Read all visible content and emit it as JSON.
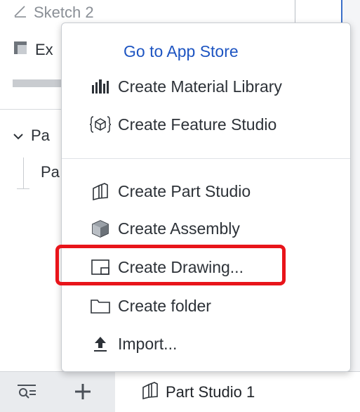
{
  "tree": {
    "sketch_label": "Sketch 2",
    "extrude_label": "Ex",
    "parts_header_label": "Pa",
    "part_item_label": "Pa"
  },
  "menu": {
    "go_to_app_store": "Go to App Store",
    "create_material_library": "Create Material Library",
    "create_feature_studio": "Create Feature Studio",
    "create_part_studio": "Create Part Studio",
    "create_assembly": "Create Assembly",
    "create_drawing": "Create Drawing...",
    "create_folder": "Create folder",
    "import": "Import..."
  },
  "tabbar": {
    "active_tab_label": "Part Studio 1"
  },
  "colors": {
    "link": "#1e55c2",
    "highlight": "#e8141a",
    "text": "#2d3238"
  }
}
